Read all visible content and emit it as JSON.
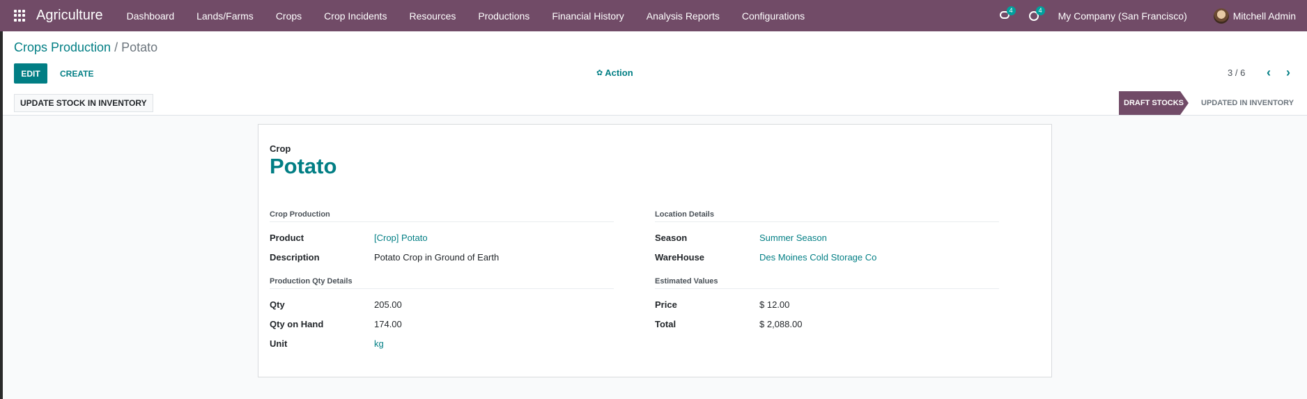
{
  "app": {
    "name": "Agriculture"
  },
  "menu": [
    "Dashboard",
    "Lands/Farms",
    "Crops",
    "Crop Incidents",
    "Resources",
    "Productions",
    "Financial History",
    "Analysis Reports",
    "Configurations"
  ],
  "systray": {
    "messages_count": "4",
    "activities_count": "4",
    "company": "My Company (San Francisco)",
    "user": "Mitchell Admin"
  },
  "breadcrumb": {
    "parent": "Crops Production",
    "separator": "/",
    "current": "Potato"
  },
  "buttons": {
    "edit": "EDIT",
    "create": "CREATE",
    "action": "Action",
    "update_stock": "UPDATE STOCK IN INVENTORY"
  },
  "pager": {
    "value": "3 / 6"
  },
  "stages": {
    "active": "DRAFT STOCKS",
    "next": "UPDATED IN INVENTORY"
  },
  "form": {
    "crop_label": "Crop",
    "crop_name": "Potato",
    "crop_production": {
      "heading": "Crop Production",
      "product_label": "Product",
      "product": "[Crop] Potato",
      "description_label": "Description",
      "description": "Potato Crop in Ground of Earth"
    },
    "location": {
      "heading": "Location Details",
      "season_label": "Season",
      "season": "Summer Season",
      "warehouse_label": "WareHouse",
      "warehouse": "Des Moines Cold Storage Co"
    },
    "qty": {
      "heading": "Production Qty Details",
      "qty_label": "Qty",
      "qty": "205.00",
      "on_hand_label": "Qty on Hand",
      "on_hand": "174.00",
      "unit_label": "Unit",
      "unit": "kg"
    },
    "estimated": {
      "heading": "Estimated Values",
      "price_label": "Price",
      "price": "$ 12.00",
      "total_label": "Total",
      "total": "$ 2,088.00"
    }
  }
}
